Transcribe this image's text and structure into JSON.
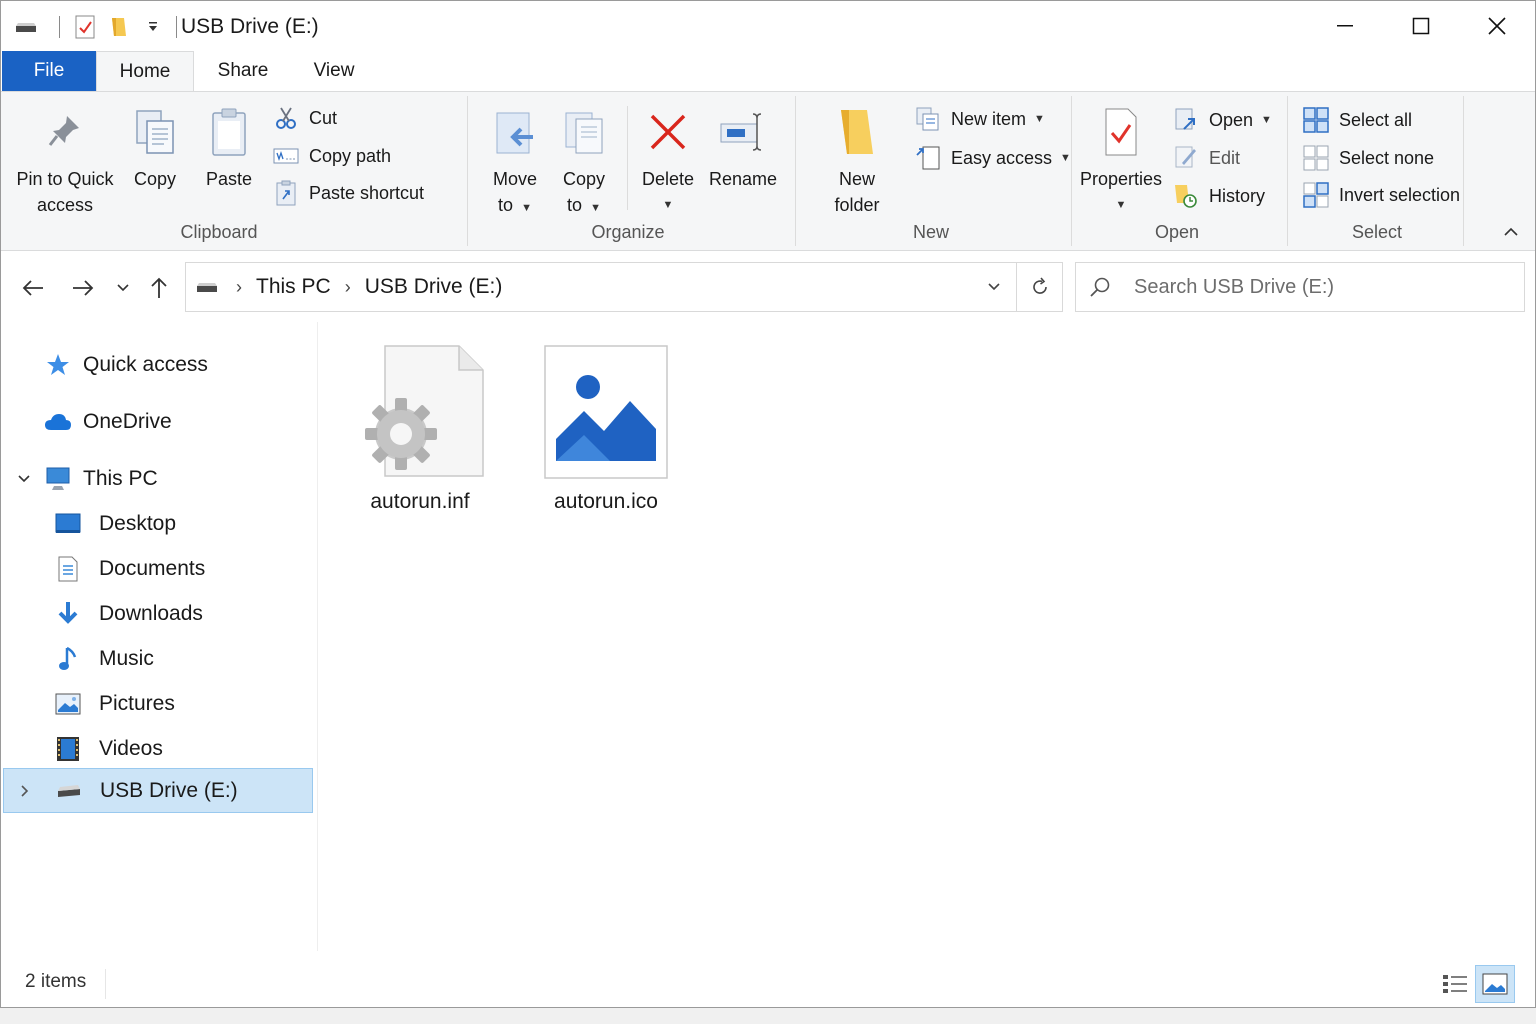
{
  "window": {
    "title": "USB Drive (E:)",
    "controls": {
      "minimize_icon": "minimize-icon",
      "maximize_icon": "maximize-icon",
      "close_icon": "close-icon"
    }
  },
  "tabs": [
    {
      "label": "File",
      "active": false,
      "accent": "#1a62c4"
    },
    {
      "label": "Home",
      "active": true
    },
    {
      "label": "Share",
      "active": false
    },
    {
      "label": "View",
      "active": false
    }
  ],
  "ribbon": {
    "clipboard": {
      "label": "Clipboard",
      "pin_line1": "Pin to Quick",
      "pin_line2": "access",
      "copy": "Copy",
      "paste": "Paste",
      "cut": "Cut",
      "copy_path": "Copy path",
      "paste_shortcut": "Paste shortcut"
    },
    "organize": {
      "label": "Organize",
      "move_line1": "Move",
      "move_line2": "to",
      "copy_line1": "Copy",
      "copy_line2": "to",
      "delete": "Delete",
      "rename": "Rename"
    },
    "new": {
      "label": "New",
      "folder_line1": "New",
      "folder_line2": "folder",
      "new_item": "New item",
      "easy_access": "Easy access"
    },
    "open": {
      "label": "Open",
      "properties": "Properties",
      "open": "Open",
      "edit": "Edit",
      "history": "History"
    },
    "select": {
      "label": "Select",
      "select_all": "Select all",
      "select_none": "Select none",
      "invert": "Invert selection"
    }
  },
  "address": {
    "crumbs": [
      "This PC",
      "USB Drive (E:)"
    ],
    "search_placeholder": "Search USB Drive (E:)"
  },
  "nav": {
    "quick_access": "Quick access",
    "onedrive": "OneDrive",
    "this_pc": "This PC",
    "desktop": "Desktop",
    "documents": "Documents",
    "downloads": "Downloads",
    "music": "Music",
    "pictures": "Pictures",
    "videos": "Videos",
    "usb": "USB Drive (E:)"
  },
  "files": [
    {
      "name": "autorun.inf",
      "icon": "settings-file-icon"
    },
    {
      "name": "autorun.ico",
      "icon": "image-file-icon"
    }
  ],
  "status": {
    "count": "2 items"
  },
  "colors": {
    "accent": "#1a62c4",
    "selection": "#cce4f7",
    "selection_border": "#99c9ef",
    "ribbon_bg": "#f5f6f7"
  }
}
